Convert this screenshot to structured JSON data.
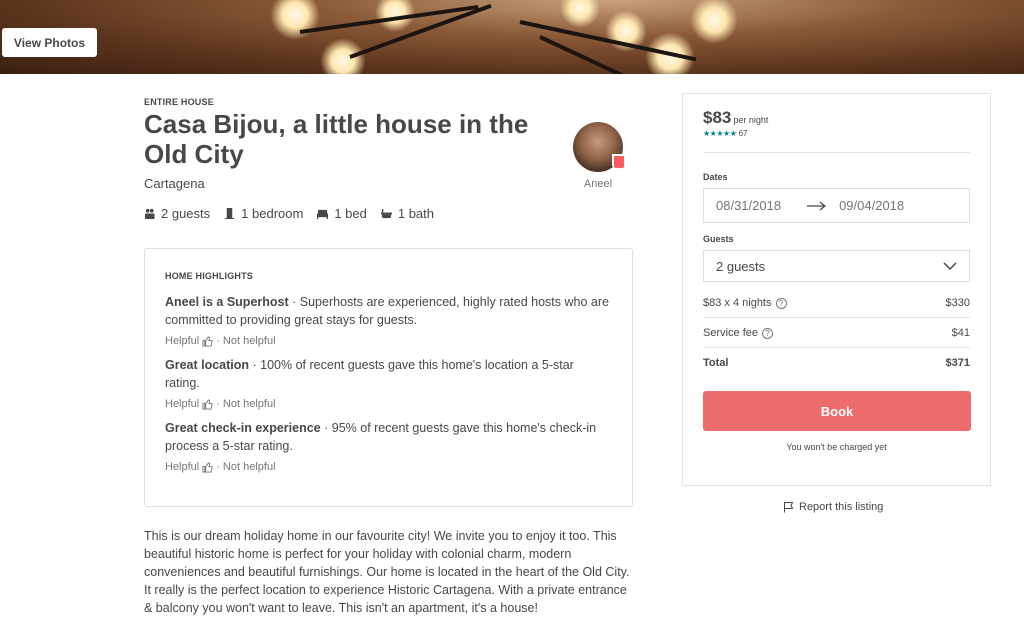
{
  "hero": {
    "view_photos_label": "View Photos"
  },
  "listing": {
    "type": "ENTIRE HOUSE",
    "title": "Casa Bijou, a little house in the Old City",
    "city": "Cartagena",
    "host_name": "Aneel",
    "amenities": [
      {
        "icon": "guests-icon",
        "label": "2 guests"
      },
      {
        "icon": "bedroom-icon",
        "label": "1 bedroom"
      },
      {
        "icon": "bed-icon",
        "label": "1 bed"
      },
      {
        "icon": "bath-icon",
        "label": "1 bath"
      }
    ]
  },
  "highlights": {
    "heading": "HOME HIGHLIGHTS",
    "items": [
      {
        "title": "Aneel is a Superhost",
        "text": " · Superhosts are experienced, highly rated hosts who are committed to providing great stays for guests.",
        "helpful": "Helpful",
        "not_helpful": "Not helpful"
      },
      {
        "title": "Great location",
        "text": " · 100% of recent guests gave this home's location a 5-star rating.",
        "helpful": "Helpful",
        "not_helpful": "Not helpful"
      },
      {
        "title": "Great check-in experience",
        "text": " · 95% of recent guests gave this home's check-in process a 5-star rating.",
        "helpful": "Helpful",
        "not_helpful": "Not helpful"
      }
    ]
  },
  "description": "This is our dream holiday home in our favourite city! We invite you to enjoy it too. This beautiful historic home is perfect for your holiday with colonial charm, modern conveniences and beautiful furnishings. Our home is located in the heart of the Old City. It really is the perfect location to experience Historic Cartagena. With a private entrance & balcony you won't want to leave. This isn't an apartment, it's a house!",
  "booking": {
    "price": "$83",
    "per_night": "per night",
    "stars": "★★★★★",
    "review_count": "67",
    "dates_label": "Dates",
    "check_in": "08/31/2018",
    "check_out": "09/04/2018",
    "guests_label": "Guests",
    "guests_value": "2 guests",
    "line_nights_label": "$83 x 4 nights",
    "line_nights_value": "$330",
    "service_fee_label": "Service fee",
    "service_fee_value": "$41",
    "total_label": "Total",
    "total_value": "$371",
    "book_label": "Book",
    "charge_note": "You won't be charged yet",
    "report_label": "Report this listing"
  },
  "colors": {
    "accent": "#ed6c6c",
    "teal": "#008489",
    "text": "#484848"
  }
}
